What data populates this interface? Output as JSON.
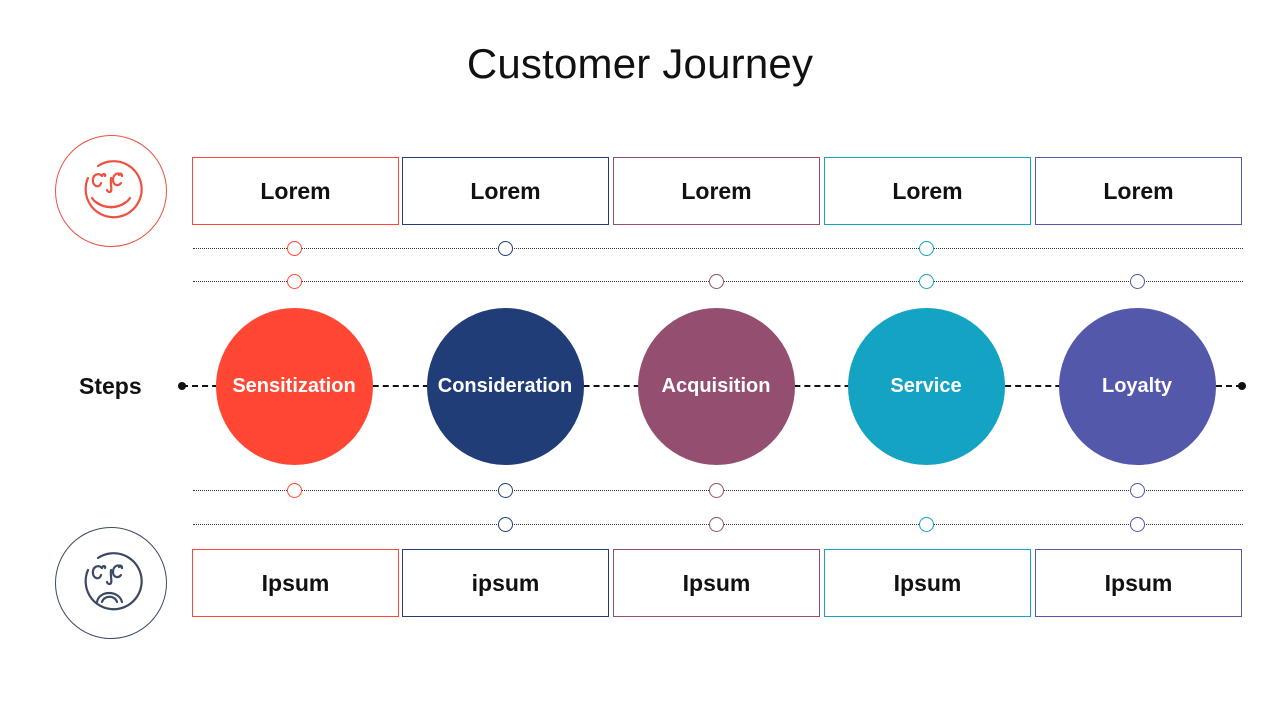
{
  "title": "Customer Journey",
  "colors": {
    "sensitization": "#FF4733",
    "consideration": "#213D78",
    "acquisition": "#944F70",
    "service": "#14A3C2",
    "loyalty": "#5358AB",
    "happy_face": "#F0503F",
    "sad_face": "#3B4A63"
  },
  "top_row": {
    "icon": "happy-face-icon",
    "boxes": [
      "Lorem",
      "Lorem",
      "Lorem",
      "Lorem",
      "Lorem"
    ]
  },
  "steps": {
    "label": "Steps",
    "items": [
      {
        "label": "Sensitization",
        "color_key": "sensitization"
      },
      {
        "label": "Consideration",
        "color_key": "consideration"
      },
      {
        "label": "Acquisition",
        "color_key": "acquisition"
      },
      {
        "label": "Service",
        "color_key": "service"
      },
      {
        "label": "Loyalty",
        "color_key": "loyalty"
      }
    ]
  },
  "bottom_row": {
    "icon": "sad-face-icon",
    "boxes": [
      "Ipsum",
      "ipsum",
      "Ipsum",
      "Ipsum",
      "Ipsum"
    ]
  },
  "markers": {
    "top_line_1": [
      0,
      1,
      3
    ],
    "top_line_2": [
      0,
      2,
      3,
      4
    ],
    "bottom_line_1": [
      0,
      1,
      2,
      4
    ],
    "bottom_line_2": [
      1,
      2,
      3,
      4
    ]
  }
}
